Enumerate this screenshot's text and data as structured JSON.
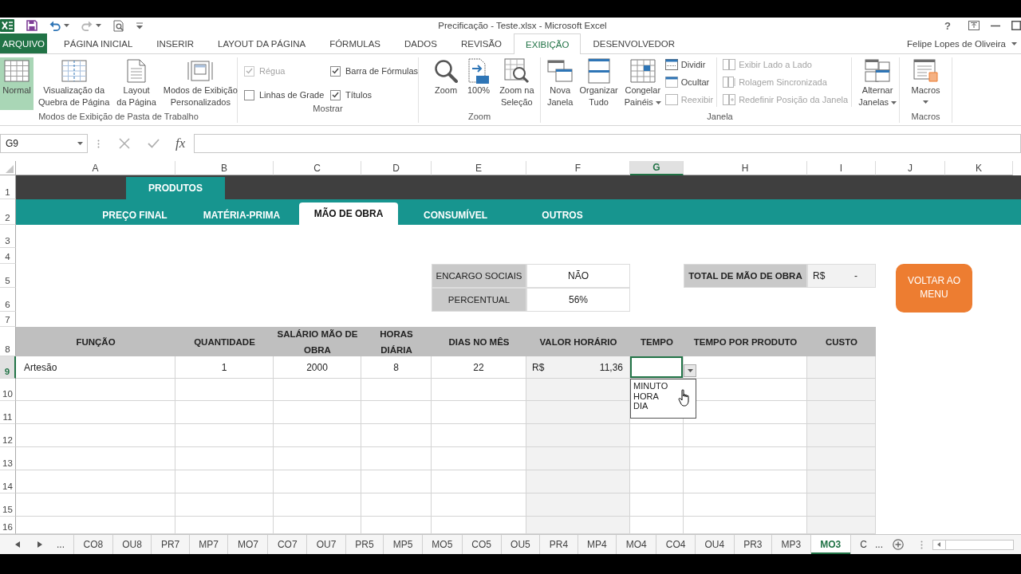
{
  "title_bar": {
    "title": "Precificação - Teste.xlsx - Microsoft Excel",
    "help": "?"
  },
  "ribbon_tabs": [
    {
      "label": "ARQUIVO",
      "kind": "file",
      "selected": false
    },
    {
      "label": "PÁGINA INICIAL",
      "kind": "tab",
      "selected": false
    },
    {
      "label": "INSERIR",
      "kind": "tab",
      "selected": false
    },
    {
      "label": "LAYOUT DA PÁGINA",
      "kind": "tab",
      "selected": false
    },
    {
      "label": "FÓRMULAS",
      "kind": "tab",
      "selected": false
    },
    {
      "label": "DADOS",
      "kind": "tab",
      "selected": false
    },
    {
      "label": "REVISÃO",
      "kind": "tab",
      "selected": false
    },
    {
      "label": "EXIBIÇÃO",
      "kind": "tab",
      "selected": true
    },
    {
      "label": "DESENVOLVEDOR",
      "kind": "tab",
      "selected": false
    }
  ],
  "account": {
    "name": "Felipe Lopes de Oliveira"
  },
  "ribbon_groups": [
    {
      "kind": "views",
      "label": "Modos de Exibição de Pasta de Trabalho",
      "buttons": [
        {
          "label": "Normal",
          "selected": true
        },
        {
          "label": "Visualização da\nQuebra de Página",
          "selected": false
        },
        {
          "label": "Layout\nda Página",
          "selected": false
        },
        {
          "label": "Modos de Exibição\nPersonalizados",
          "selected": false
        }
      ]
    },
    {
      "kind": "show",
      "label": "Mostrar",
      "options": [
        {
          "label": "Régua",
          "checked": true,
          "disabled": true
        },
        {
          "label": "Linhas de Grade",
          "checked": false,
          "disabled": false
        },
        {
          "label": "Barra de Fórmulas",
          "checked": true,
          "disabled": false
        },
        {
          "label": "Títulos",
          "checked": true,
          "disabled": false
        }
      ]
    },
    {
      "kind": "zoom",
      "label": "Zoom",
      "buttons": [
        {
          "label": "Zoom"
        },
        {
          "label": "100%"
        },
        {
          "label": "Zoom na\nSeleção"
        }
      ]
    },
    {
      "kind": "window",
      "label": "Janela",
      "large": [
        {
          "label": "Nova\nJanela",
          "dropdown": false
        },
        {
          "label": "Organizar\nTudo",
          "dropdown": false
        },
        {
          "label": "Congelar\nPainéis",
          "dropdown": true
        }
      ],
      "small": [
        {
          "label": "Dividir",
          "disabled": false
        },
        {
          "label": "Ocultar",
          "disabled": false
        },
        {
          "label": "Reexibir",
          "disabled": true
        }
      ],
      "compare": [
        {
          "label": "Exibir Lado a Lado",
          "disabled": true
        },
        {
          "label": "Rolagem Sincronizada",
          "disabled": true
        },
        {
          "label": "Redefinir Posição da Janela",
          "disabled": true
        }
      ],
      "switch": {
        "label": "Alternar\nJanelas",
        "dropdown": true
      }
    },
    {
      "kind": "macros",
      "label": "Macros",
      "buttons": [
        {
          "label": "Macros",
          "dropdown": true
        }
      ]
    }
  ],
  "formula_bar": {
    "name_box": "G9",
    "function_label": "fx"
  },
  "column_headers": [
    {
      "label": "A",
      "selected": false
    },
    {
      "label": "B",
      "selected": false
    },
    {
      "label": "C",
      "selected": false
    },
    {
      "label": "D",
      "selected": false
    },
    {
      "label": "E",
      "selected": false
    },
    {
      "label": "F",
      "selected": false
    },
    {
      "label": "G",
      "selected": true
    },
    {
      "label": "H",
      "selected": false
    },
    {
      "label": "I",
      "selected": false
    },
    {
      "label": "J",
      "selected": false
    },
    {
      "label": "K",
      "selected": false
    }
  ],
  "row_headers": [
    {
      "label": "1",
      "selected": false
    },
    {
      "label": "2",
      "selected": false
    },
    {
      "label": "3",
      "selected": false
    },
    {
      "label": "4",
      "selected": false
    },
    {
      "label": "5",
      "selected": false
    },
    {
      "label": "6",
      "selected": false
    },
    {
      "label": "7",
      "selected": false
    },
    {
      "label": "8",
      "selected": false
    },
    {
      "label": "9",
      "selected": true
    },
    {
      "label": "10",
      "selected": false
    },
    {
      "label": "11",
      "selected": false
    },
    {
      "label": "12",
      "selected": false
    },
    {
      "label": "13",
      "selected": false
    },
    {
      "label": "14",
      "selected": false
    },
    {
      "label": "15",
      "selected": false
    },
    {
      "label": "16",
      "selected": false
    }
  ],
  "sheet_nav": {
    "title": "PRODUTOS",
    "tabs": [
      {
        "label": "PREÇO FINAL",
        "selected": false
      },
      {
        "label": "MATÉRIA-PRIMA",
        "selected": false
      },
      {
        "label": "MÃO DE OBRA",
        "selected": true
      },
      {
        "label": "CONSUMÍVEL",
        "selected": false
      },
      {
        "label": "OUTROS",
        "selected": false
      }
    ]
  },
  "encargos": [
    {
      "label": "ENCARGO SOCIAIS",
      "value": "NÃO"
    },
    {
      "label": "PERCENTUAL",
      "value": "56%"
    }
  ],
  "total": {
    "label": "TOTAL DE MÃO DE OBRA",
    "currency": "R$",
    "value": "-"
  },
  "menu_button": {
    "label": "VOLTAR AO MENU"
  },
  "table": {
    "columns": [
      {
        "label": "FUNÇÃO",
        "shaded": false
      },
      {
        "label": "QUANTIDADE",
        "shaded": false
      },
      {
        "label": "SALÁRIO MÃO DE OBRA",
        "shaded": false
      },
      {
        "label": "HORAS DIÁRIA",
        "shaded": false
      },
      {
        "label": "DIAS NO MÊS",
        "shaded": false
      },
      {
        "label": "VALOR HORÁRIO",
        "shaded": true
      },
      {
        "label": "TEMPO",
        "shaded": false
      },
      {
        "label": "TEMPO POR PRODUTO",
        "shaded": false
      },
      {
        "label": "CUSTO",
        "shaded": true
      }
    ],
    "rows": [
      {
        "cells": [
          {
            "kind": "text",
            "text": "Artesão",
            "selected": false
          },
          {
            "kind": "number",
            "text": "1",
            "selected": false
          },
          {
            "kind": "number",
            "text": "2000",
            "selected": false
          },
          {
            "kind": "number",
            "text": "8",
            "selected": false
          },
          {
            "kind": "number",
            "text": "22",
            "selected": false
          },
          {
            "kind": "currency",
            "currency": "R$",
            "text": "11,36",
            "selected": false
          },
          {
            "kind": "list",
            "selected": true,
            "expanded": true,
            "options": [
              "MINUTO",
              "HORA",
              "DIA"
            ]
          },
          {
            "kind": "empty",
            "selected": false
          },
          {
            "kind": "empty",
            "selected": false
          }
        ]
      }
    ]
  },
  "sheet_tabs": {
    "more_before": "...",
    "tabs": [
      {
        "label": "CO8",
        "selected": false
      },
      {
        "label": "OU8",
        "selected": false
      },
      {
        "label": "PR7",
        "selected": false
      },
      {
        "label": "MP7",
        "selected": false
      },
      {
        "label": "MO7",
        "selected": false
      },
      {
        "label": "CO7",
        "selected": false
      },
      {
        "label": "OU7",
        "selected": false
      },
      {
        "label": "PR5",
        "selected": false
      },
      {
        "label": "MP5",
        "selected": false
      },
      {
        "label": "MO5",
        "selected": false
      },
      {
        "label": "CO5",
        "selected": false
      },
      {
        "label": "OU5",
        "selected": false
      },
      {
        "label": "PR4",
        "selected": false
      },
      {
        "label": "MP4",
        "selected": false
      },
      {
        "label": "MO4",
        "selected": false
      },
      {
        "label": "CO4",
        "selected": false
      },
      {
        "label": "OU4",
        "selected": false
      },
      {
        "label": "PR3",
        "selected": false
      },
      {
        "label": "MP3",
        "selected": false
      },
      {
        "label": "MO3",
        "selected": true
      },
      {
        "label": "C",
        "selected": false
      }
    ],
    "more_after": "..."
  }
}
